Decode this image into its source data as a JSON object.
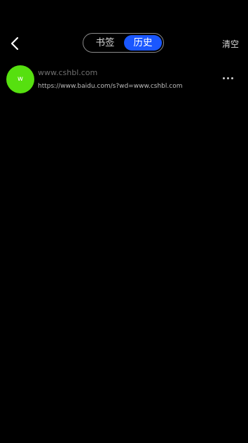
{
  "header": {
    "back_icon": "chevron-left-icon",
    "tabs": [
      {
        "label": "书签",
        "active": false
      },
      {
        "label": "历史",
        "active": true
      }
    ],
    "clear_label": "清空"
  },
  "history": {
    "items": [
      {
        "avatar_letter": "w",
        "avatar_color": "#56e00f",
        "title": "www.cshbl.com",
        "url": "https://www.baidu.com/s?wd=www.cshbl.com",
        "more_icon": "more-horizontal-icon"
      }
    ]
  },
  "colors": {
    "background": "#000000",
    "active_tab": "#1a57ff",
    "avatar": "#56e00f"
  }
}
